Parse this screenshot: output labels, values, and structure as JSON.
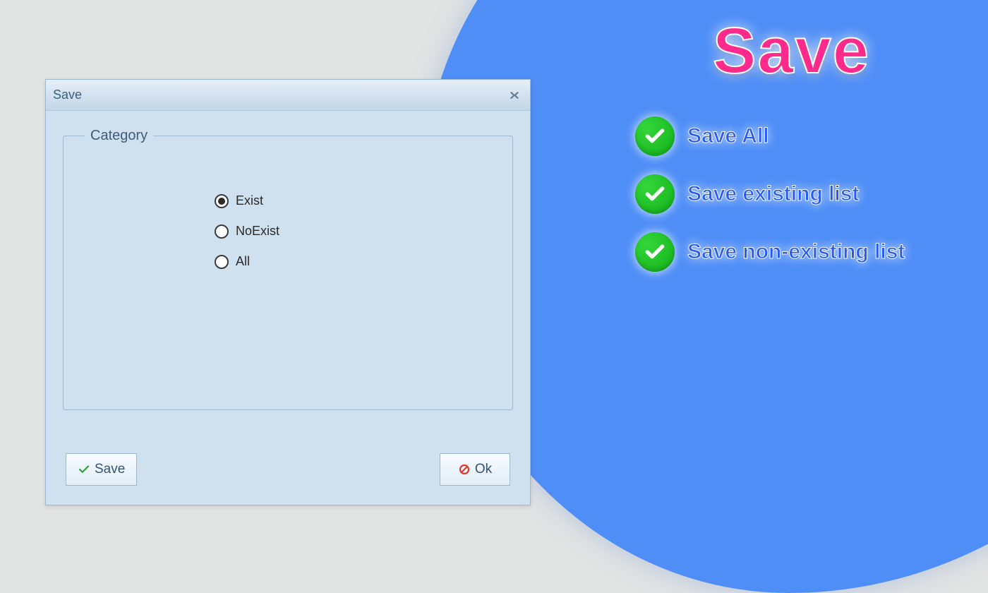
{
  "promo": {
    "title": "Save",
    "items": [
      {
        "label": "Save All"
      },
      {
        "label": "Save existing list"
      },
      {
        "label": "Save non-existing list"
      }
    ]
  },
  "dialog": {
    "title": "Save",
    "category_legend": "Category",
    "options": [
      {
        "label": "Exist",
        "selected": true
      },
      {
        "label": "NoExist",
        "selected": false
      },
      {
        "label": "All",
        "selected": false
      }
    ],
    "buttons": {
      "save": "Save",
      "ok": "Ok"
    }
  }
}
